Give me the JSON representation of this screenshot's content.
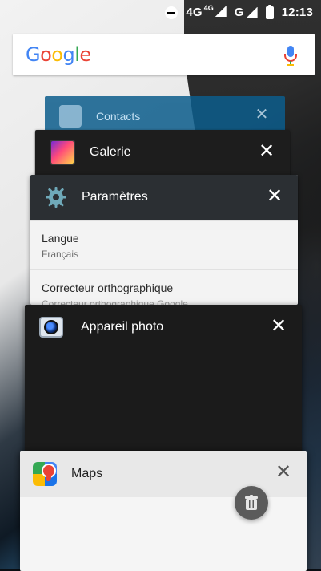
{
  "status_bar": {
    "network": "4G",
    "network_sup": "4G",
    "carrier": "G",
    "time": "12:13"
  },
  "google": {
    "logo": [
      "G",
      "o",
      "o",
      "g",
      "l",
      "e"
    ]
  },
  "recent_apps": [
    {
      "title": "Contacts",
      "icon": "contacts-icon"
    },
    {
      "title": "Galerie",
      "icon": "gallery-icon"
    },
    {
      "title": "Paramètres",
      "icon": "gear-icon",
      "rows": [
        {
          "label": "Langue",
          "value": "Français"
        },
        {
          "label": "Correcteur orthographique",
          "value": "Correcteur orthographique Google"
        }
      ]
    },
    {
      "title": "Appareil photo",
      "icon": "camera-icon"
    },
    {
      "title": "Maps",
      "icon": "maps-icon"
    }
  ],
  "colors": {
    "google_blue": "#4285F4",
    "google_red": "#EA4335",
    "google_yellow": "#FBBC05",
    "google_green": "#34A853"
  }
}
